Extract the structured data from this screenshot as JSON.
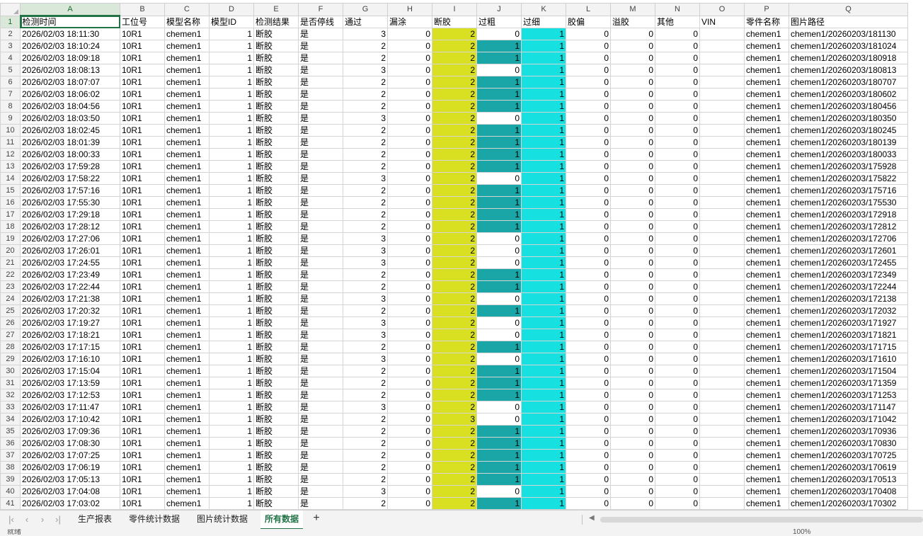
{
  "columns": [
    "A",
    "B",
    "C",
    "D",
    "E",
    "F",
    "G",
    "H",
    "I",
    "J",
    "K",
    "L",
    "M",
    "N",
    "O",
    "P",
    "Q"
  ],
  "headers": [
    "检测时间",
    "工位号",
    "模型名称",
    "模型ID",
    "检测结果",
    "是否停线",
    "通过",
    "漏涂",
    "断胶",
    "过粗",
    "过细",
    "胶偏",
    "溢胶",
    "其他",
    "VIN",
    "零件名称",
    "图片路径"
  ],
  "rows": [
    {
      "time": "2026/02/03 18:11:30",
      "pass": 3,
      "coarse": 0,
      "path": "chemen1/20260203/181130"
    },
    {
      "time": "2026/02/03 18:10:24",
      "pass": 2,
      "coarse": 1,
      "path": "chemen1/20260203/181024"
    },
    {
      "time": "2026/02/03 18:09:18",
      "pass": 2,
      "coarse": 1,
      "path": "chemen1/20260203/180918"
    },
    {
      "time": "2026/02/03 18:08:13",
      "pass": 3,
      "coarse": 0,
      "path": "chemen1/20260203/180813"
    },
    {
      "time": "2026/02/03 18:07:07",
      "pass": 2,
      "coarse": 1,
      "path": "chemen1/20260203/180707"
    },
    {
      "time": "2026/02/03 18:06:02",
      "pass": 2,
      "coarse": 1,
      "path": "chemen1/20260203/180602"
    },
    {
      "time": "2026/02/03 18:04:56",
      "pass": 2,
      "coarse": 1,
      "path": "chemen1/20260203/180456"
    },
    {
      "time": "2026/02/03 18:03:50",
      "pass": 3,
      "coarse": 0,
      "path": "chemen1/20260203/180350"
    },
    {
      "time": "2026/02/03 18:02:45",
      "pass": 2,
      "coarse": 1,
      "path": "chemen1/20260203/180245"
    },
    {
      "time": "2026/02/03 18:01:39",
      "pass": 2,
      "coarse": 1,
      "path": "chemen1/20260203/180139"
    },
    {
      "time": "2026/02/03 18:00:33",
      "pass": 2,
      "coarse": 1,
      "path": "chemen1/20260203/180033"
    },
    {
      "time": "2026/02/03 17:59:28",
      "pass": 2,
      "coarse": 1,
      "path": "chemen1/20260203/175928"
    },
    {
      "time": "2026/02/03 17:58:22",
      "pass": 3,
      "coarse": 0,
      "path": "chemen1/20260203/175822"
    },
    {
      "time": "2026/02/03 17:57:16",
      "pass": 2,
      "coarse": 1,
      "path": "chemen1/20260203/175716"
    },
    {
      "time": "2026/02/03 17:55:30",
      "pass": 2,
      "coarse": 1,
      "path": "chemen1/20260203/175530"
    },
    {
      "time": "2026/02/03 17:29:18",
      "pass": 2,
      "coarse": 1,
      "path": "chemen1/20260203/172918"
    },
    {
      "time": "2026/02/03 17:28:12",
      "pass": 2,
      "coarse": 1,
      "path": "chemen1/20260203/172812"
    },
    {
      "time": "2026/02/03 17:27:06",
      "pass": 3,
      "coarse": 0,
      "path": "chemen1/20260203/172706"
    },
    {
      "time": "2026/02/03 17:26:01",
      "pass": 3,
      "coarse": 0,
      "path": "chemen1/20260203/172601"
    },
    {
      "time": "2026/02/03 17:24:55",
      "pass": 3,
      "coarse": 0,
      "path": "chemen1/20260203/172455"
    },
    {
      "time": "2026/02/03 17:23:49",
      "pass": 2,
      "coarse": 1,
      "path": "chemen1/20260203/172349"
    },
    {
      "time": "2026/02/03 17:22:44",
      "pass": 2,
      "coarse": 1,
      "path": "chemen1/20260203/172244"
    },
    {
      "time": "2026/02/03 17:21:38",
      "pass": 3,
      "coarse": 0,
      "path": "chemen1/20260203/172138"
    },
    {
      "time": "2026/02/03 17:20:32",
      "pass": 2,
      "coarse": 1,
      "path": "chemen1/20260203/172032"
    },
    {
      "time": "2026/02/03 17:19:27",
      "pass": 3,
      "coarse": 0,
      "path": "chemen1/20260203/171927"
    },
    {
      "time": "2026/02/03 17:18:21",
      "pass": 3,
      "coarse": 0,
      "path": "chemen1/20260203/171821"
    },
    {
      "time": "2026/02/03 17:17:15",
      "pass": 2,
      "coarse": 1,
      "path": "chemen1/20260203/171715"
    },
    {
      "time": "2026/02/03 17:16:10",
      "pass": 3,
      "coarse": 0,
      "path": "chemen1/20260203/171610"
    },
    {
      "time": "2026/02/03 17:15:04",
      "pass": 2,
      "coarse": 1,
      "path": "chemen1/20260203/171504"
    },
    {
      "time": "2026/02/03 17:13:59",
      "pass": 2,
      "coarse": 1,
      "path": "chemen1/20260203/171359"
    },
    {
      "time": "2026/02/03 17:12:53",
      "pass": 2,
      "coarse": 1,
      "path": "chemen1/20260203/171253"
    },
    {
      "time": "2026/02/03 17:11:47",
      "pass": 3,
      "coarse": 0,
      "path": "chemen1/20260203/171147"
    },
    {
      "time": "2026/02/03 17:10:42",
      "pass": 2,
      "coarse": 0,
      "break": 3,
      "path": "chemen1/20260203/171042"
    },
    {
      "time": "2026/02/03 17:09:36",
      "pass": 2,
      "coarse": 1,
      "path": "chemen1/20260203/170936"
    },
    {
      "time": "2026/02/03 17:08:30",
      "pass": 2,
      "coarse": 1,
      "path": "chemen1/20260203/170830"
    },
    {
      "time": "2026/02/03 17:07:25",
      "pass": 2,
      "coarse": 1,
      "path": "chemen1/20260203/170725"
    },
    {
      "time": "2026/02/03 17:06:19",
      "pass": 2,
      "coarse": 1,
      "path": "chemen1/20260203/170619"
    },
    {
      "time": "2026/02/03 17:05:13",
      "pass": 2,
      "coarse": 1,
      "path": "chemen1/20260203/170513"
    },
    {
      "time": "2026/02/03 17:04:08",
      "pass": 3,
      "coarse": 0,
      "path": "chemen1/20260203/170408"
    },
    {
      "time": "2026/02/03 17:03:02",
      "pass": 2,
      "coarse": 1,
      "path": "chemen1/20260203/170302"
    }
  ],
  "constants": {
    "station": "10R1",
    "model_name": "chemen1",
    "model_id": 1,
    "result": "断胶",
    "stop_line": "是",
    "miss": 0,
    "break": 2,
    "thin": 1,
    "offset": 0,
    "overflow": 0,
    "other": 0,
    "vin": "",
    "part": "chemen1"
  },
  "tabs": [
    "生产报表",
    "零件统计数据",
    "图片统计数据",
    "所有数据"
  ],
  "active_tab": "所有数据",
  "nav": {
    "first": "|‹",
    "prev": "‹",
    "next": "›",
    "last": "›|",
    "add": "+"
  },
  "status": {
    "left": "就绪",
    "zoom": "100%"
  },
  "colors": {
    "break_fill": "#d9e021",
    "coarse_fill": "#1aa6a6",
    "thin_fill": "#17e0e0",
    "select": "#217346"
  }
}
